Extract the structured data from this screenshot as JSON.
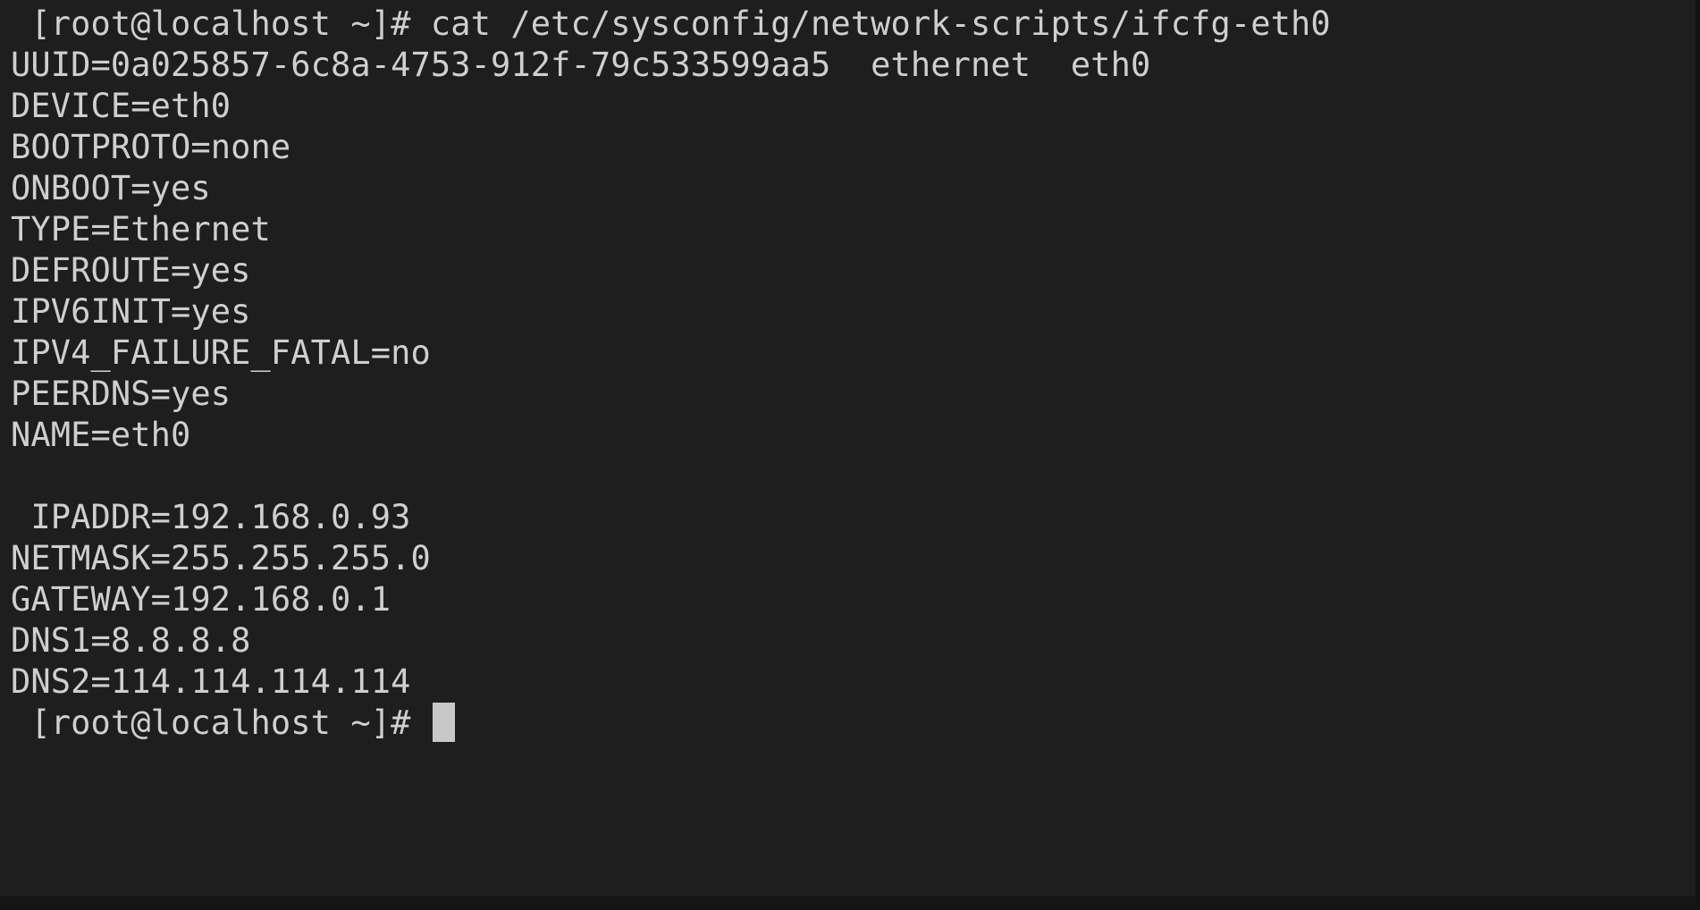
{
  "terminal": {
    "app_name": "terminal",
    "background_color": "#1e1e1e",
    "foreground_color": "#cfcfcf",
    "cursor_color": "#c8c8c8",
    "prompt": "[root@localhost ~]#",
    "command": "cat /etc/sysconfig/network-scripts/ifcfg-eth0",
    "lines": [
      {
        "id": "line-command",
        "text": " [root@localhost ~]# cat /etc/sysconfig/network-scripts/ifcfg-eth0"
      },
      {
        "id": "line-uuid",
        "text": "UUID=0a025857-6c8a-4753-912f-79c533599aa5  ethernet  eth0"
      },
      {
        "id": "line-device",
        "text": "DEVICE=eth0"
      },
      {
        "id": "line-bootproto",
        "text": "BOOTPROTO=none"
      },
      {
        "id": "line-onboot",
        "text": "ONBOOT=yes"
      },
      {
        "id": "line-type",
        "text": "TYPE=Ethernet"
      },
      {
        "id": "line-defroute",
        "text": "DEFROUTE=yes"
      },
      {
        "id": "line-ipv6init",
        "text": "IPV6INIT=yes"
      },
      {
        "id": "line-ipv4-failure",
        "text": "IPV4_FAILURE_FATAL=no"
      },
      {
        "id": "line-peerdns",
        "text": "PEERDNS=yes"
      },
      {
        "id": "line-name",
        "text": "NAME=eth0"
      },
      {
        "id": "line-blank",
        "text": " "
      },
      {
        "id": "line-ipaddr",
        "text": " IPADDR=192.168.0.93"
      },
      {
        "id": "line-netmask",
        "text": "NETMASK=255.255.255.0"
      },
      {
        "id": "line-gateway",
        "text": "GATEWAY=192.168.0.1"
      },
      {
        "id": "line-dns1",
        "text": "DNS1=8.8.8.8"
      },
      {
        "id": "line-dns2",
        "text": "DNS2=114.114.114.114"
      }
    ],
    "final_prompt": " [root@localhost ~]# ",
    "config": {
      "UUID": "0a025857-6c8a-4753-912f-79c533599aa5",
      "UUID_TYPE": "ethernet",
      "UUID_IFACE": "eth0",
      "DEVICE": "eth0",
      "BOOTPROTO": "none",
      "ONBOOT": "yes",
      "TYPE": "Ethernet",
      "DEFROUTE": "yes",
      "IPV6INIT": "yes",
      "IPV4_FAILURE_FATAL": "no",
      "PEERDNS": "yes",
      "NAME": "eth0",
      "IPADDR": "192.168.0.93",
      "NETMASK": "255.255.255.0",
      "GATEWAY": "192.168.0.1",
      "DNS1": "8.8.8.8",
      "DNS2": "114.114.114.114"
    }
  }
}
